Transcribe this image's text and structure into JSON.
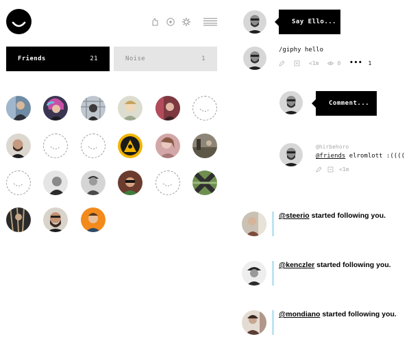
{
  "header": {
    "logo": "ello-logo",
    "icons": [
      "discover-icon",
      "search-icon",
      "settings-icon"
    ],
    "menu_icon": "hamburger-menu-icon"
  },
  "tabs": [
    {
      "label": "Friends",
      "count": "21",
      "active": true
    },
    {
      "label": "Noise",
      "count": "1",
      "active": false
    }
  ],
  "friend_avatars": [
    "photo",
    "photo",
    "photo",
    "photo",
    "photo",
    "placeholder",
    "photo",
    "placeholder",
    "placeholder",
    "photo",
    "photo",
    "photo",
    "placeholder",
    "photo",
    "photo",
    "photo",
    "placeholder",
    "photo",
    "photo",
    "photo",
    "photo"
  ],
  "feed": {
    "say_ello": "Say Ello...",
    "post": {
      "text": "/giphy hello",
      "time": "<1m",
      "views": "0",
      "more": "•••",
      "reposts": "1"
    },
    "comment_placeholder": "Comment...",
    "comment": {
      "username": "@hirbehoro",
      "mention": "@friends",
      "text": "elromlott :((((",
      "time": "<1m"
    },
    "notifications": [
      {
        "handle": "@steerio",
        "text": " started following you."
      },
      {
        "handle": "@kenczler",
        "text": " started following you."
      },
      {
        "handle": "@mondiano",
        "text": " started following you."
      }
    ]
  },
  "colors": {
    "black": "#000000",
    "noise_tab": "#e5e5e5",
    "notif_bar": "#bfe3f2",
    "muted": "#aaaaaa"
  }
}
